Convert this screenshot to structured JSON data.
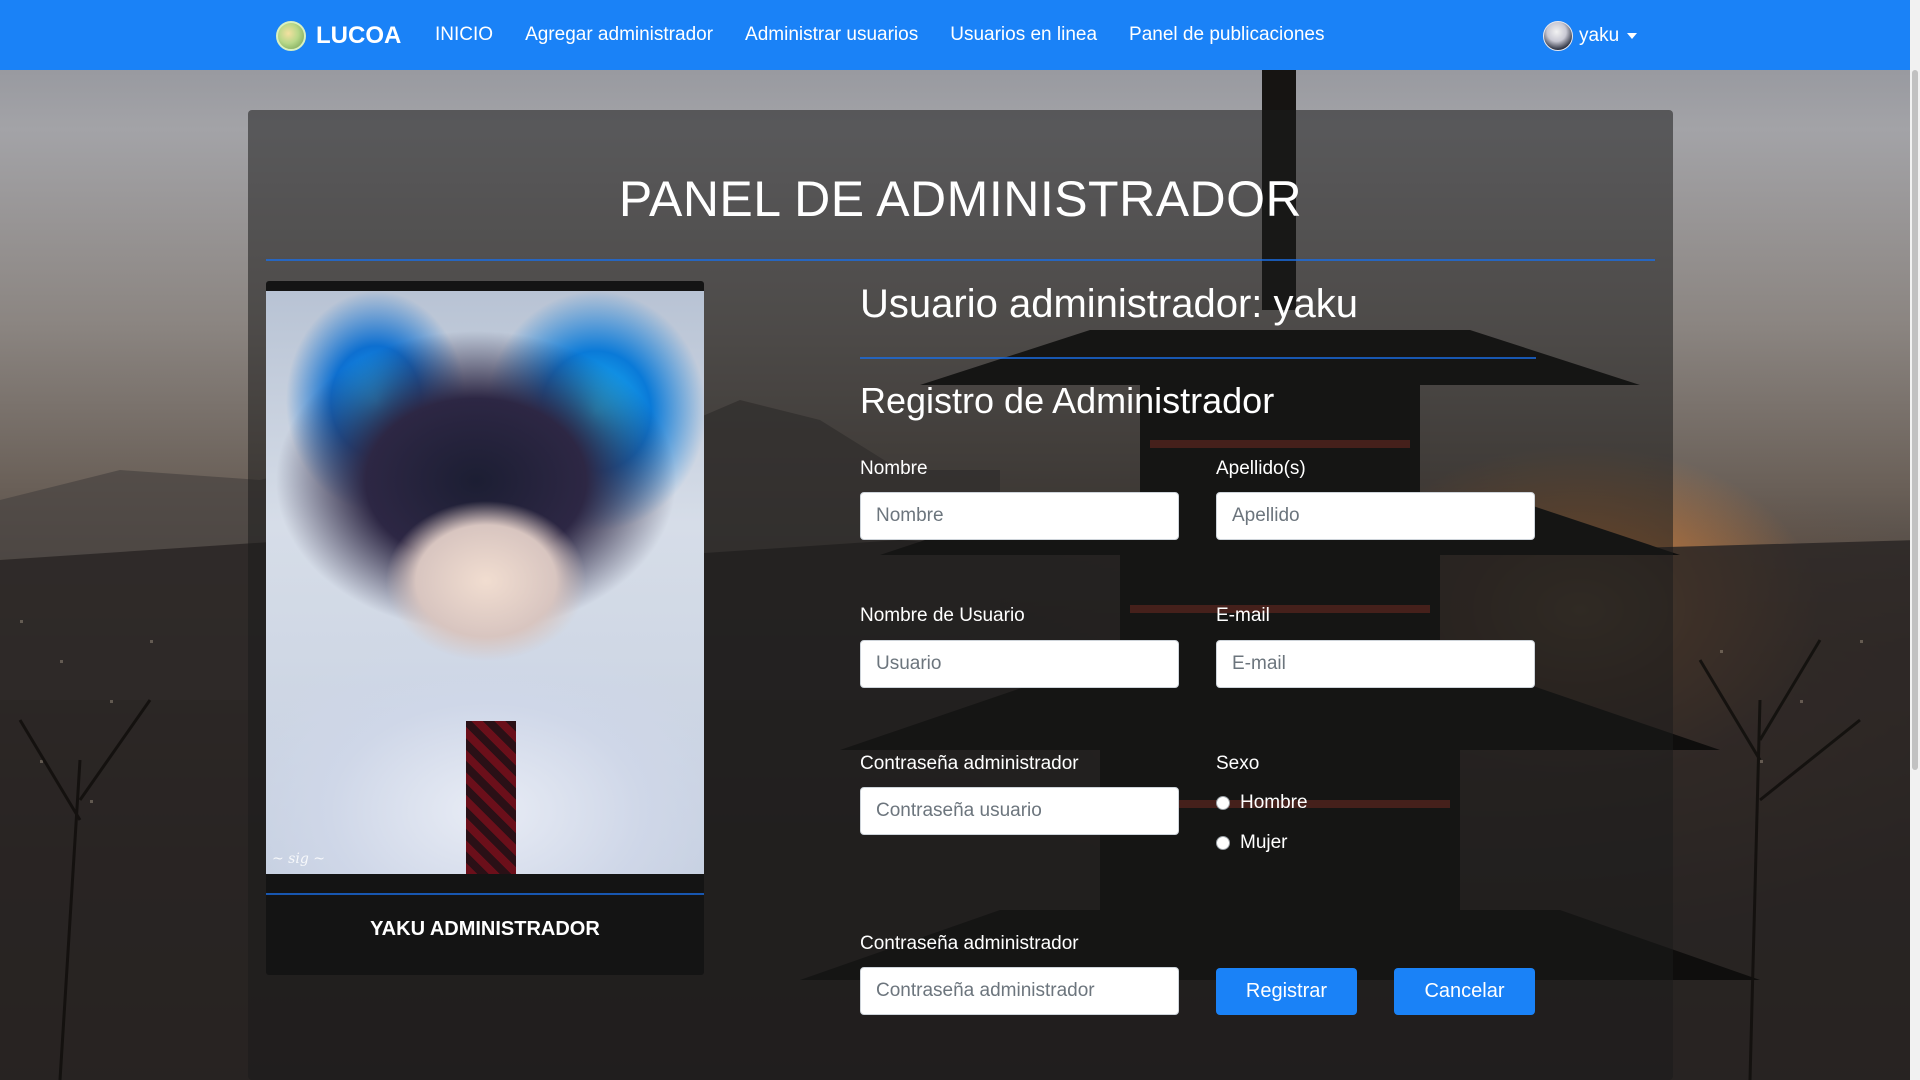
{
  "navbar": {
    "brand": "LUCOA",
    "links": [
      "INICIO",
      "Agregar administrador",
      "Administrar usuarios",
      "Usuarios en linea",
      "Panel de publicaciones"
    ],
    "user": "yaku",
    "brand_color": "#1a82f7"
  },
  "panel": {
    "title": "PANEL DE ADMINISTRADOR"
  },
  "profile": {
    "name": "YAKU ADMINISTRADOR"
  },
  "form": {
    "admin_user": "Usuario administrador: yaku",
    "title": "Registro de Administrador",
    "nombre_label": "Nombre",
    "nombre_placeholder": "Nombre",
    "apellido_label": "Apellido(s)",
    "apellido_placeholder": "Apellido",
    "usuario_label": "Nombre de Usuario",
    "usuario_placeholder": "Usuario",
    "email_label": "E-mail",
    "email_placeholder": "E-mail",
    "pass_usuario_label": "Contraseña administrador",
    "pass_usuario_placeholder": "Contraseña usuario",
    "sexo_label": "Sexo",
    "sexo_options": [
      "Hombre",
      "Mujer"
    ],
    "pass_admin_label": "Contraseña administrador",
    "pass_admin_placeholder": "Contraseña administrador",
    "submit_label": "Registrar",
    "cancel_label": "Cancelar"
  }
}
